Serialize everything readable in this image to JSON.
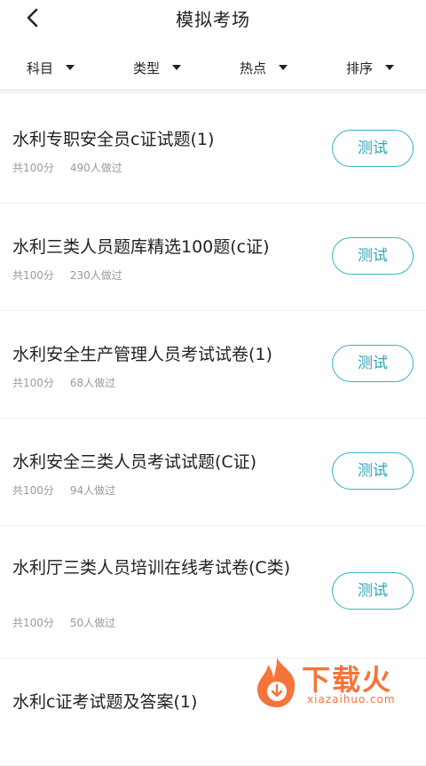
{
  "header": {
    "title": "模拟考场",
    "back_icon": "back-chevron-icon"
  },
  "filters": [
    {
      "label": "科目"
    },
    {
      "label": "类型"
    },
    {
      "label": "热点"
    },
    {
      "label": "排序"
    }
  ],
  "exams": [
    {
      "title": "水利专职安全员c证试题(1)",
      "total": "共100分",
      "takers": "490人做过",
      "button": "测试"
    },
    {
      "title": "水利三类人员题库精选100题(c证)",
      "total": "共100分",
      "takers": "230人做过",
      "button": "测试"
    },
    {
      "title": "水利安全生产管理人员考试试卷(1)",
      "total": "共100分",
      "takers": "68人做过",
      "button": "测试"
    },
    {
      "title": "水利安全三类人员考试试题(C证)",
      "total": "共100分",
      "takers": "94人做过",
      "button": "测试"
    },
    {
      "title": "水利厅三类人员培训在线考试卷(C类)",
      "total": "共100分",
      "takers": "50人做过",
      "button": "测试"
    },
    {
      "title": "水利c证考试题及答案(1)"
    }
  ],
  "watermark": {
    "brand": "下载火",
    "domain": "xiazaihuo.com",
    "color": "#f4743b"
  },
  "colors": {
    "accent": "#39b3c4",
    "text": "#222222",
    "meta": "#9a9a9a"
  }
}
